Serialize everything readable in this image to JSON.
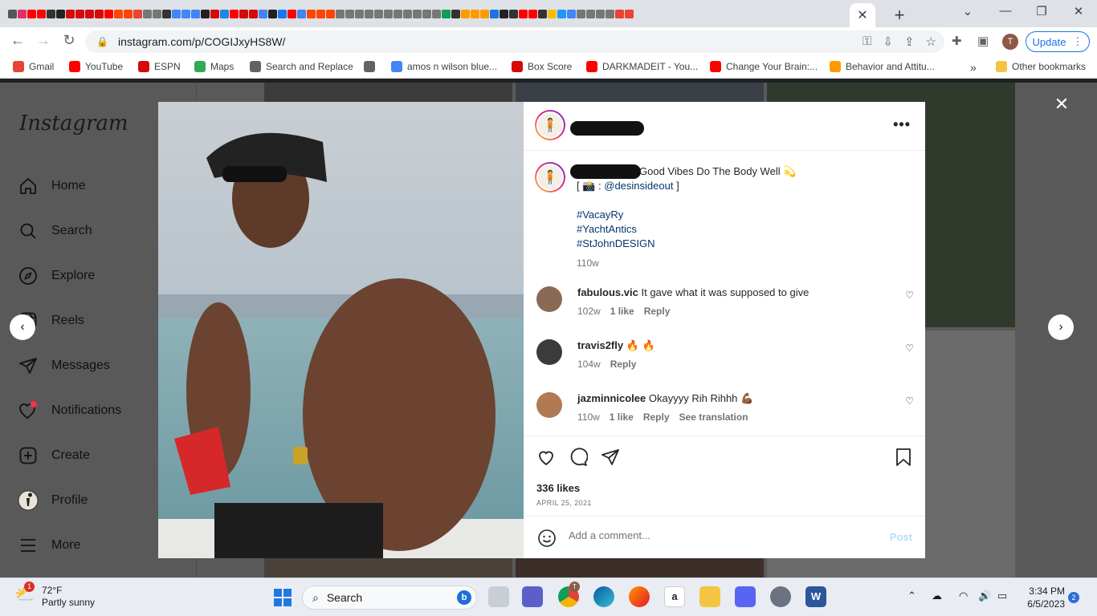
{
  "browser": {
    "url": "instagram.com/p/COGIJxyHS8W/",
    "update_label": "Update",
    "profile_initial": "T",
    "bookmarks": [
      {
        "label": "Gmail",
        "icon": "gmail-icon",
        "color": "#ea4335"
      },
      {
        "label": "YouTube",
        "icon": "youtube-icon",
        "color": "#ff0000"
      },
      {
        "label": "ESPN",
        "icon": "espn-icon",
        "color": "#d50a0a"
      },
      {
        "label": "Maps",
        "icon": "maps-icon",
        "color": "#34a853"
      },
      {
        "label": "Search and Replace",
        "icon": "search-replace-icon",
        "color": "#5f6368"
      },
      {
        "label": "",
        "icon": "globe-icon",
        "color": "#5f6368"
      },
      {
        "label": "amos n wilson blue...",
        "icon": "google-icon",
        "color": "#4285f4"
      },
      {
        "label": "Box Score",
        "icon": "espn-icon",
        "color": "#d50a0a"
      },
      {
        "label": "DARKMADEIT - You...",
        "icon": "youtube-icon",
        "color": "#ff0000"
      },
      {
        "label": "Change Your Brain:...",
        "icon": "youtube-icon",
        "color": "#ff0000"
      },
      {
        "label": "Behavior and Attitu...",
        "icon": "amazon-icon",
        "color": "#ff9900"
      }
    ],
    "more_bookmarks": "»",
    "other_bookmarks": "Other bookmarks",
    "tab_favicon_colors": [
      "#555",
      "#e1306c",
      "#ff0000",
      "#ff0000",
      "#333",
      "#222",
      "#d50a0a",
      "#d50a0a",
      "#d50a0a",
      "#d50a0a",
      "#ff0000",
      "#ff4500",
      "#ff4500",
      "#ea4335",
      "#777",
      "#777",
      "#333",
      "#4285f4",
      "#4285f4",
      "#4285f4",
      "#222",
      "#d50a0a",
      "#1e88e5",
      "#ff0000",
      "#d50a0a",
      "#d50a0a",
      "#4285f4",
      "#222",
      "#1877f2",
      "#ff0000",
      "#4285f4",
      "#ff4500",
      "#ff4500",
      "#ff4500",
      "#777",
      "#777",
      "#777",
      "#777",
      "#777",
      "#777",
      "#777",
      "#777",
      "#777",
      "#777",
      "#777",
      "#0f9d58",
      "#333",
      "#ff9900",
      "#ff9900",
      "#ff9900",
      "#1a73e8",
      "#222",
      "#333",
      "#ff0000",
      "#ff0000",
      "#333",
      "#fbbc05",
      "#2196f3",
      "#4285f4",
      "#777",
      "#777",
      "#777",
      "#777",
      "#ea4335",
      "#ea4335"
    ]
  },
  "instagram": {
    "logo": "Instagram",
    "nav": [
      {
        "label": "Home",
        "icon": "home-icon"
      },
      {
        "label": "Search",
        "icon": "search-icon"
      },
      {
        "label": "Explore",
        "icon": "compass-icon"
      },
      {
        "label": "Reels",
        "icon": "reels-icon"
      },
      {
        "label": "Messages",
        "icon": "send-icon"
      },
      {
        "label": "Notifications",
        "icon": "heart-icon"
      },
      {
        "label": "Create",
        "icon": "plus-square-icon"
      },
      {
        "label": "Profile",
        "icon": "profile-avatar"
      },
      {
        "label": "More",
        "icon": "menu-icon"
      }
    ],
    "post": {
      "caption_text": "Good Vibes Do The Body Well 💫",
      "credit_prefix": "[ 📸 : ",
      "credit_mention": "@desinsideout",
      "credit_suffix": " ]",
      "hashtags": [
        "#VacayRy",
        "#YachtAntics",
        "#StJohnDESIGN"
      ],
      "caption_age": "110w",
      "comments": [
        {
          "user": "fabulous.vic",
          "text": "It gave what it was supposed to give",
          "age": "102w",
          "likes": "1 like",
          "reply": "Reply",
          "translate": ""
        },
        {
          "user": "travis2fly",
          "text": "🔥 🔥",
          "age": "104w",
          "likes": "",
          "reply": "Reply",
          "translate": ""
        },
        {
          "user": "jazminnicolee",
          "text": "Okayyyy Rih Rihhh 💪🏾",
          "age": "110w",
          "likes": "1 like",
          "reply": "Reply",
          "translate": "See translation"
        }
      ],
      "likes": "336 likes",
      "date": "APRIL 25, 2021",
      "comment_placeholder": "Add a comment...",
      "post_button": "Post"
    }
  },
  "taskbar": {
    "temperature": "72°F",
    "condition": "Partly sunny",
    "weather_badge": "1",
    "search_label": "Search",
    "time": "3:34 PM",
    "date": "6/5/2023",
    "notification_count": "2",
    "chrome_badge": "T"
  }
}
